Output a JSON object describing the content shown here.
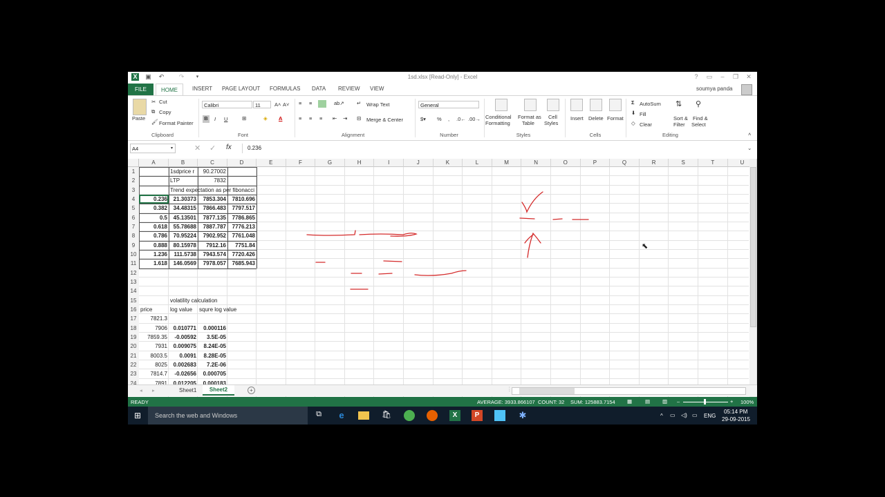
{
  "window": {
    "title": "1sd.xlsx [Read-Only] - Excel",
    "user": "soumya panda",
    "help": "?",
    "minimize": "–",
    "maximize": "❐",
    "close": "✕"
  },
  "ribbon_tabs": [
    "FILE",
    "HOME",
    "INSERT",
    "PAGE LAYOUT",
    "FORMULAS",
    "DATA",
    "REVIEW",
    "VIEW"
  ],
  "ribbon": {
    "clipboard": {
      "paste": "Paste",
      "cut": "Cut",
      "copy": "Copy",
      "format_painter": "Format Painter",
      "label": "Clipboard"
    },
    "font": {
      "name": "Calibri",
      "size": "11",
      "label": "Font",
      "bold": "B",
      "italic": "I",
      "underline": "U"
    },
    "alignment": {
      "wrap_text": "Wrap Text",
      "merge_center": "Merge & Center",
      "label": "Alignment"
    },
    "number": {
      "format": "General",
      "percent": "%",
      "comma": ",",
      "label": "Number"
    },
    "styles": {
      "conditional": "Conditional",
      "conditional2": "Formatting",
      "format_as": "Format as",
      "format_as2": "Table",
      "cell": "Cell",
      "cell2": "Styles",
      "label": "Styles"
    },
    "cells": {
      "insert": "Insert",
      "delete": "Delete",
      "format": "Format",
      "label": "Cells"
    },
    "editing": {
      "autosum": "AutoSum",
      "fill": "Fill",
      "clear": "Clear",
      "sort": "Sort &",
      "sort2": "Filter",
      "find": "Find &",
      "find2": "Select",
      "label": "Editing"
    }
  },
  "formula_bar": {
    "name_box": "A4",
    "value": "0.236",
    "fx": "fx"
  },
  "columns": [
    "A",
    "B",
    "C",
    "D",
    "E",
    "F",
    "G",
    "H",
    "I",
    "J",
    "K",
    "L",
    "M",
    "N",
    "O",
    "P",
    "Q",
    "R",
    "S",
    "T",
    "U"
  ],
  "rows": [
    "1",
    "2",
    "3",
    "4",
    "5",
    "6",
    "7",
    "8",
    "9",
    "10",
    "11",
    "12",
    "13",
    "14",
    "15",
    "16",
    "17",
    "18",
    "19",
    "20",
    "21",
    "22",
    "23",
    "24"
  ],
  "cells": {
    "B1": "1sdprice r",
    "C1": "90.27002",
    "B2": "LTP",
    "C2": "7832",
    "B3": "Trend expectation as per fibonacci",
    "fib_table": [
      [
        "0.236",
        "21.30373",
        "7853.304",
        "7810.696"
      ],
      [
        "0.382",
        "34.48315",
        "7866.483",
        "7797.517"
      ],
      [
        "0.5",
        "45.13501",
        "7877.135",
        "7786.865"
      ],
      [
        "0.618",
        "55.78688",
        "7887.787",
        "7776.213"
      ],
      [
        "0.786",
        "70.95224",
        "7902.952",
        "7761.048"
      ],
      [
        "0.888",
        "80.15978",
        "7912.16",
        "7751.84"
      ],
      [
        "1.236",
        "111.5738",
        "7943.574",
        "7720.426"
      ],
      [
        "1.618",
        "146.0569",
        "7978.057",
        "7685.943"
      ]
    ],
    "B15": "volatility calculation",
    "A16": "price",
    "B16": "log value",
    "C16": "squre log value",
    "vol_table": [
      [
        "7821.3",
        "",
        ""
      ],
      [
        "7906",
        "0.010771",
        "0.000116"
      ],
      [
        "7859.35",
        "-0.00592",
        "3.5E-05"
      ],
      [
        "7931",
        "0.009075",
        "8.24E-05"
      ],
      [
        "8003.5",
        "0.0091",
        "8.28E-05"
      ],
      [
        "8025",
        "0.002683",
        "7.2E-06"
      ],
      [
        "7814.7",
        "-0.02656",
        "0.000705"
      ],
      [
        "7891",
        "0.012205",
        "0.000183"
      ]
    ]
  },
  "sheets": [
    "Sheet1",
    "Sheet2"
  ],
  "active_sheet": "Sheet2",
  "status": {
    "ready": "READY",
    "average": "AVERAGE: 3933.866107",
    "count": "COUNT: 32",
    "sum": "SUM: 125883.7154",
    "zoom": "100%"
  },
  "taskbar": {
    "search_placeholder": "Search the web and Windows",
    "lang": "ENG",
    "time": "05:14 PM",
    "date": "29-09-2015"
  }
}
